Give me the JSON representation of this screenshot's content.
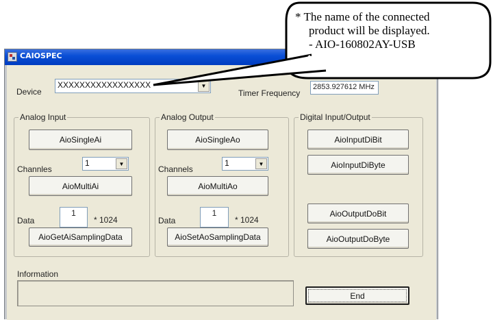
{
  "window": {
    "title": "CAIOSPEC"
  },
  "device": {
    "label": "Device",
    "value": "XXXXXXXXXXXXXXXXX"
  },
  "timer": {
    "label": "Timer Frequency",
    "value": "2853.927612 MHz"
  },
  "analog_input": {
    "title": "Analog Input",
    "single_button": "AioSingleAi",
    "channels_label": "Channles",
    "channels_value": "1",
    "multi_button": "AioMultiAi",
    "data_label": "Data",
    "data_value": "1",
    "data_suffix": "* 1024",
    "sampling_button": "AioGetAiSamplingData"
  },
  "analog_output": {
    "title": "Analog Output",
    "single_button": "AioSingleAo",
    "channels_label": "Channels",
    "channels_value": "1",
    "multi_button": "AioMultiAo",
    "data_label": "Data",
    "data_value": "1",
    "data_suffix": "* 1024",
    "sampling_button": "AioSetAoSamplingData"
  },
  "digital_io": {
    "title": "Digital Input/Output",
    "input_bit_button": "AioInputDiBit",
    "input_byte_button": "AioInputDiByte",
    "output_bit_button": "AioOutputDoBit",
    "output_byte_button": "AioOutputDoByte"
  },
  "information": {
    "label": "Information",
    "value": ""
  },
  "end_button": "End",
  "callout": {
    "line1": "* The name of the connected",
    "line2": "product will be displayed.",
    "line3": "- AIO-160802AY-USB"
  }
}
